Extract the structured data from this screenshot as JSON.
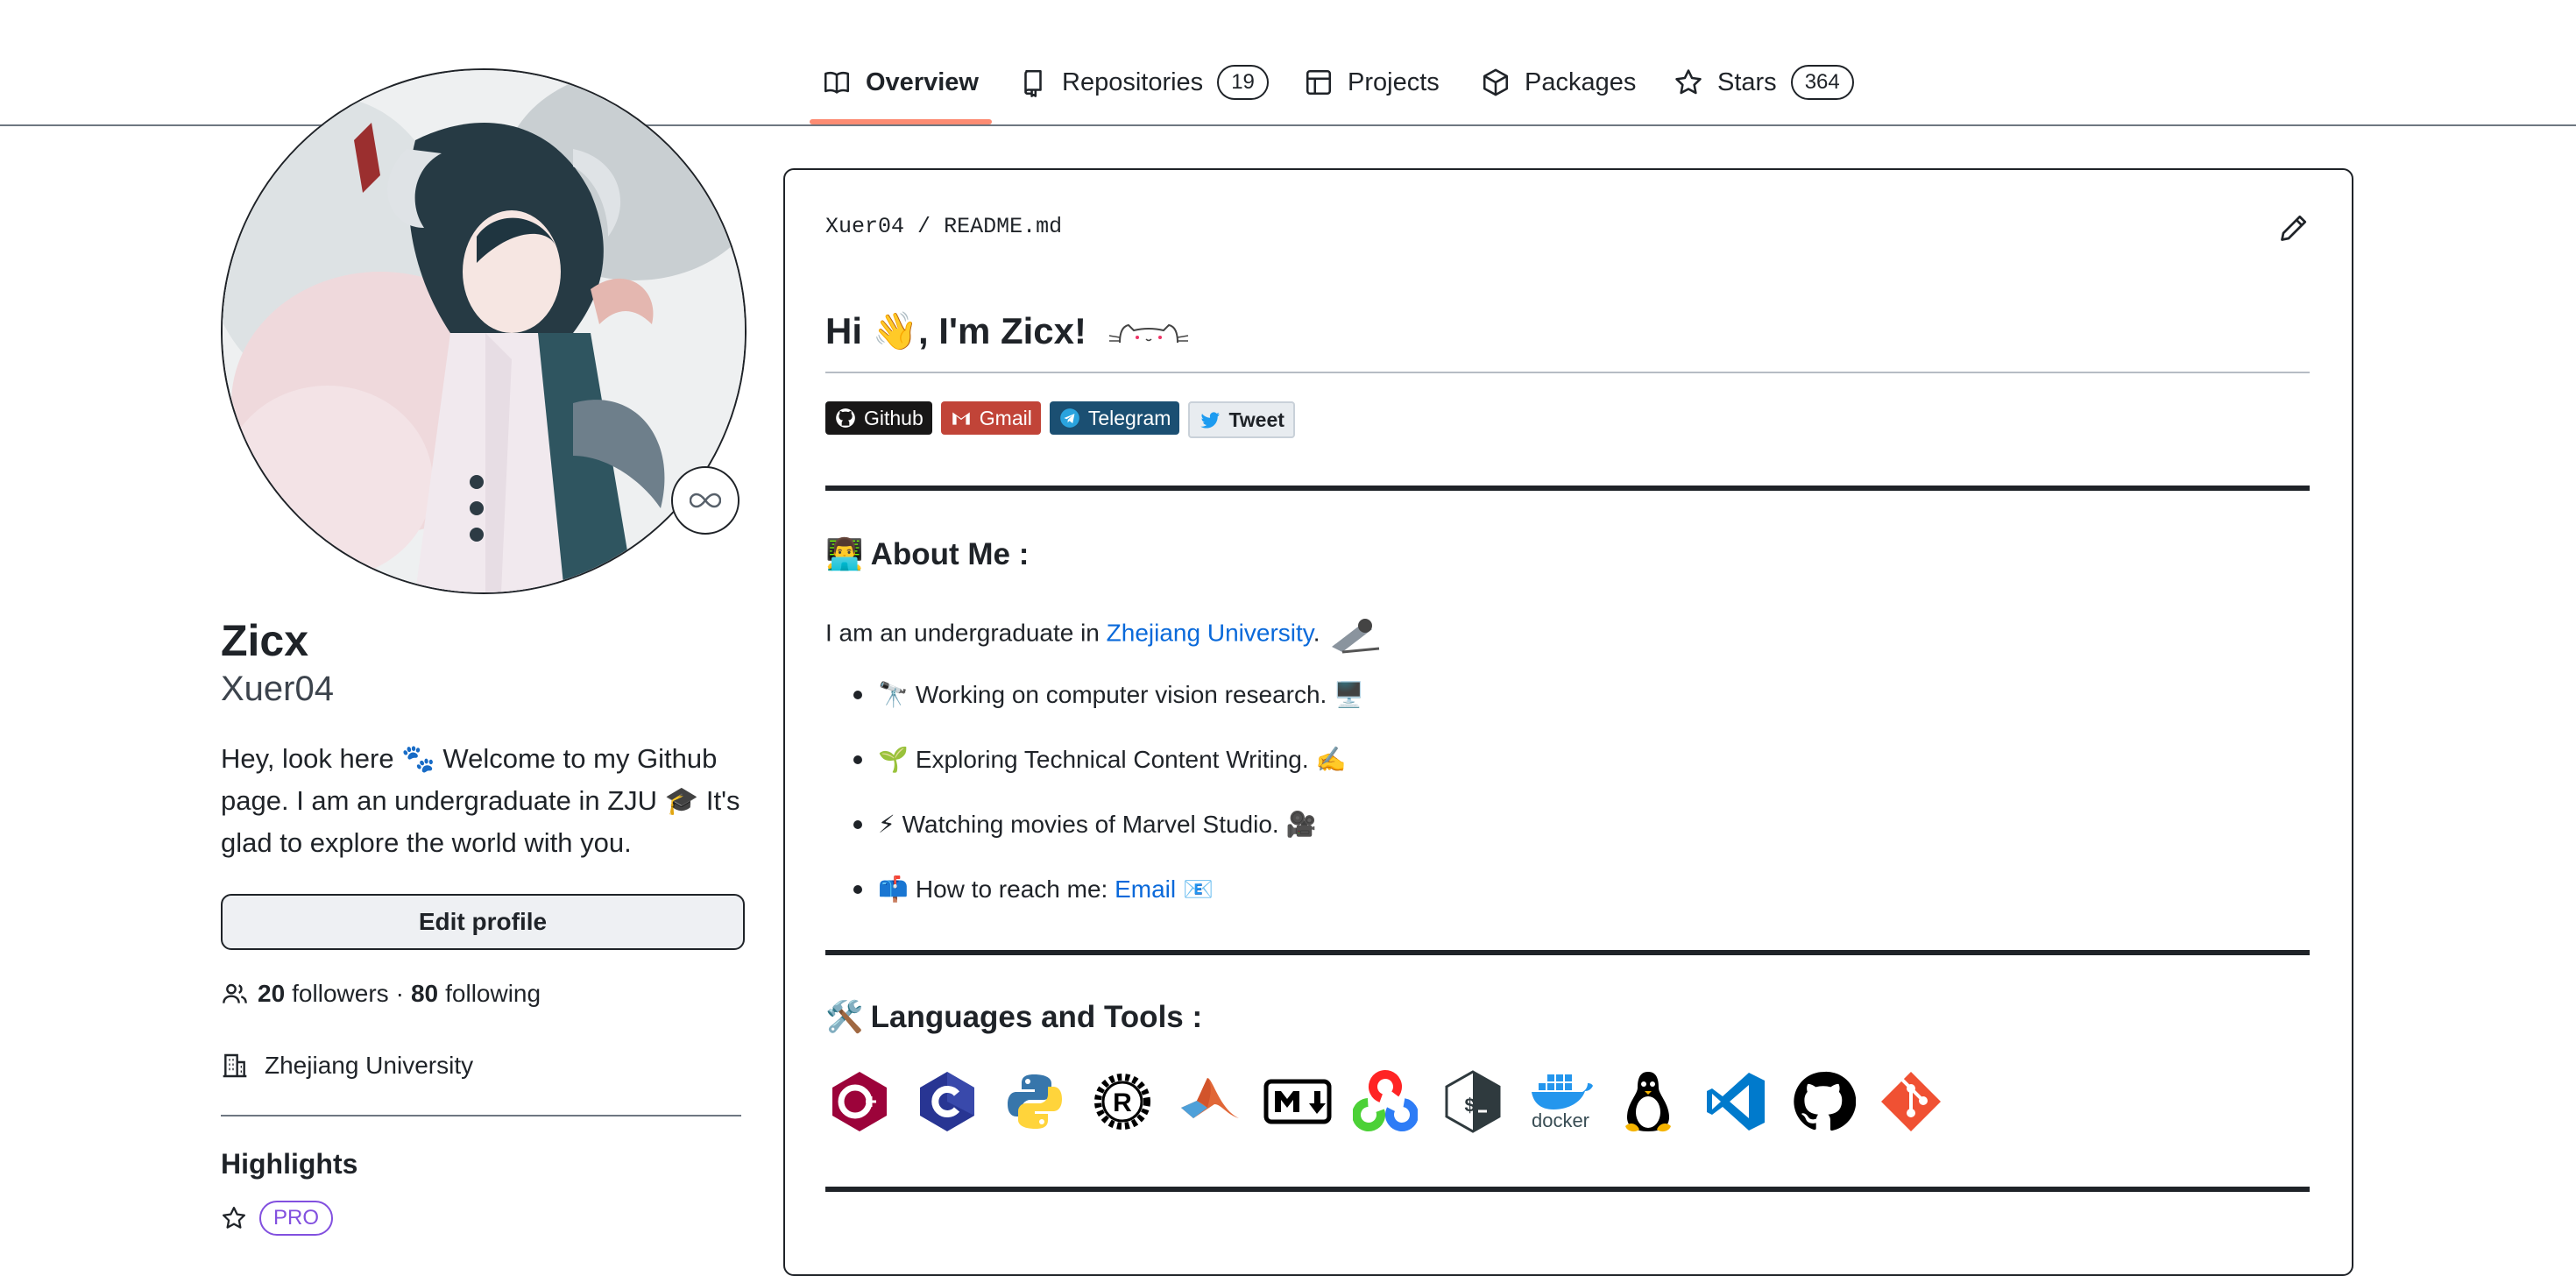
{
  "nav": {
    "tabs": [
      {
        "label": "Overview",
        "icon": "book-icon"
      },
      {
        "label": "Repositories",
        "count": "19",
        "icon": "repo-icon"
      },
      {
        "label": "Projects",
        "icon": "table-icon"
      },
      {
        "label": "Packages",
        "icon": "package-icon"
      },
      {
        "label": "Stars",
        "count": "364",
        "icon": "star-icon"
      }
    ],
    "active_color": "#fd8c73"
  },
  "profile": {
    "name": "Zicx",
    "login": "Xuer04",
    "bio": "Hey, look here 🐾 Welcome to my Github page. I am an undergraduate in ZJU 🎓 It's glad to explore the world with you.",
    "edit_button": "Edit profile",
    "followers_count": "20",
    "followers_label": "followers",
    "dot": "·",
    "following_count": "80",
    "following_label": "following",
    "organization": "Zhejiang University",
    "highlights_title": "Highlights",
    "pro_badge": "PRO",
    "status_icon": "infinity-icon"
  },
  "readme": {
    "owner": "Xuer04",
    "slash": "/",
    "file": "README.md",
    "heading": "Hi 👋, I'm Zicx!",
    "badges": [
      {
        "label": "Github",
        "color": "#181717",
        "icon": "github-icon"
      },
      {
        "label": "Gmail",
        "color": "#c14438",
        "icon": "gmail-icon"
      },
      {
        "label": "Telegram",
        "color": "#1b4f72",
        "icon": "telegram-icon"
      },
      {
        "label": "Tweet",
        "color": "#e8ecf0",
        "icon": "twitter-icon"
      }
    ],
    "about_title": "About Me :",
    "intro_prefix": "I am an undergraduate in ",
    "intro_link": "Zhejiang University",
    "intro_suffix": ".",
    "items": [
      {
        "emoji": "🔭",
        "text": "Working on computer vision research.",
        "trail": "🖥️"
      },
      {
        "emoji": "🌱",
        "text": "Exploring Technical Content Writing.",
        "trail": "✍️"
      },
      {
        "emoji": "⚡",
        "text": "Watching movies of Marvel Studio.",
        "trail": "🎥"
      }
    ],
    "reach_emoji": "📫",
    "reach_text": "How to reach me: ",
    "reach_link": "Email",
    "reach_trail": "📧",
    "tools_title": "Languages and Tools :",
    "tools": [
      "cplusplus-icon",
      "c-icon",
      "python-icon",
      "rust-icon",
      "matlab-icon",
      "markdown-icon",
      "opencv-icon",
      "bash-icon",
      "docker-icon",
      "linux-icon",
      "vscode-icon",
      "github-icon",
      "git-icon"
    ],
    "docker_label": "docker"
  }
}
